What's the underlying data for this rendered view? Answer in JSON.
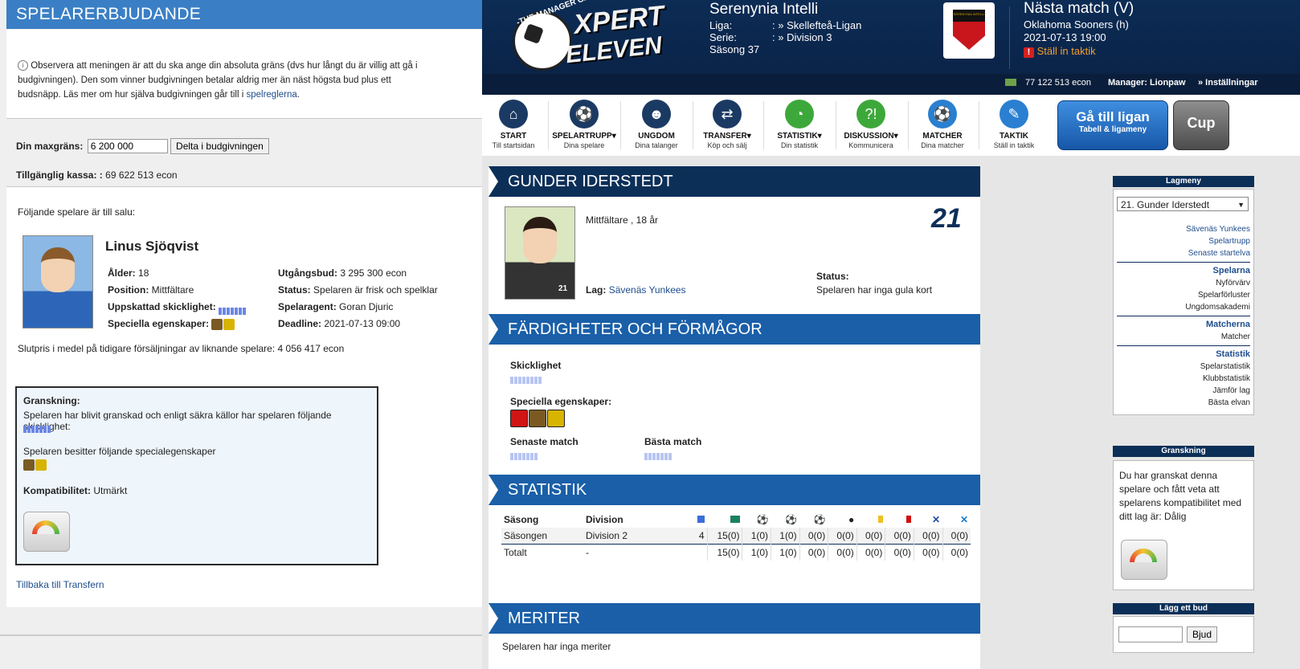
{
  "left": {
    "title": "SPELARERBJUDANDE",
    "info_text": "Observera att meningen är att du ska ange din absoluta gräns (dvs hur långt du är villig att gå i budgivningen). Den som vinner budgivningen betalar aldrig mer än näst högsta bud plus ett budsnäpp. Läs mer om hur själva budgivningen går till i",
    "info_link": "spelreglerna",
    "info_end": ".",
    "max_label": "Din maxgräns:",
    "max_value": "6 200 000",
    "join_button": "Delta i budgivningen",
    "cash_label": "Tillgänglig kassa: :",
    "cash_value": "69 622 513 econ",
    "for_sale_text": "Följande spelare är till salu:",
    "player": {
      "name": "Linus Sjöqvist",
      "age_label": "Ålder:",
      "age": "18",
      "position_label": "Position:",
      "position": "Mittfältare",
      "skill_label": "Uppskattad skicklighet:",
      "special_label": "Speciella egenskaper:",
      "start_bid_label": "Utgångsbud:",
      "start_bid": "3 295 300 econ",
      "status_label": "Status:",
      "status": "Spelaren är frisk och spelklar",
      "agent_label": "Spelaragent:",
      "agent": "Goran Djuric",
      "deadline_label": "Deadline:",
      "deadline": "2021-07-13 09:00",
      "skill_level": 7
    },
    "avg_price_text": "Slutpris i medel på tidigare försäljningar av liknande spelare: 4 056 417 econ",
    "scout": {
      "title": "Granskning:",
      "text1": "Spelaren har blivit granskad och enligt säkra källor har spelaren följande skicklighet:",
      "text2": "Spelaren besitter följande specialegenskaper",
      "compat_label": "Kompatibilitet:",
      "compat_value": "Utmärkt"
    },
    "back_link": "Tillbaka till Transfern"
  },
  "header": {
    "logo_text1": "-THE MANAGER GAME-",
    "logo_text2": "XPERT",
    "logo_text3": "ELEVEN",
    "team_name": "Serenynia Intelli",
    "liga_label": "Liga:",
    "liga_value": ": » Skellefteå-Ligan",
    "serie_label": "Serie:",
    "serie_value": ": » Division 3",
    "season": "Säsong 37",
    "badge_text": "SERENYNIA INTELLI",
    "next_match_title": "Nästa match (V)",
    "next_opponent": "Oklahoma Sooners (h)",
    "next_date": "2021-07-13 19:00",
    "tactic_link": "Ställ in taktik",
    "money": "77 122 513 econ",
    "manager": "Manager: Lionpaw",
    "settings": "» Inställningar"
  },
  "nav": [
    {
      "t1": "START",
      "t2": "Till startsidan",
      "icon": "home-icon"
    },
    {
      "t1": "SPELARTRUPP▾",
      "t2": "Dina spelare",
      "icon": "player-icon"
    },
    {
      "t1": "UNGDOM",
      "t2": "Dina talanger",
      "icon": "youth-icon"
    },
    {
      "t1": "TRANSFER▾",
      "t2": "Köp och sälj",
      "icon": "transfer-icon"
    },
    {
      "t1": "STATISTIK▾",
      "t2": "Din statistik",
      "icon": "stats-icon"
    },
    {
      "t1": "DISKUSSION▾",
      "t2": "Kommunicera",
      "icon": "discussion-icon"
    },
    {
      "t1": "MATCHER",
      "t2": "Dina matcher",
      "icon": "ball-icon"
    },
    {
      "t1": "TAKTIK",
      "t2": "Ställ in taktik",
      "icon": "tactic-icon"
    }
  ],
  "league_button": {
    "t1": "Gå till ligan",
    "t2": "Tabell & ligameny"
  },
  "cup_button": "Cup",
  "player_page": {
    "name": "GUNDER IDERSTEDT",
    "number": "21",
    "desc": "Mittfältare , 18 år",
    "team_label": "Lag:",
    "team": "Sävenäs Yunkees",
    "status_label": "Status:",
    "status_text": "Spelaren har inga gula kort",
    "skills_title": "FÄRDIGHETER OCH FÖRMÅGOR",
    "skill_label": "Skicklighet",
    "special_label": "Speciella egenskaper:",
    "last_match_label": "Senaste match",
    "best_match_label": "Bästa match",
    "stats_title": "STATISTIK",
    "col_season": "Säsong",
    "col_division": "Division",
    "rows": [
      {
        "season": "Säsongen",
        "division": "Division 2",
        "c0": "4",
        "vals": [
          "15(0)",
          "1(0)",
          "1(0)",
          "0(0)",
          "0(0)",
          "0(0)",
          "0(0)",
          "0(0)",
          "0(0)"
        ]
      },
      {
        "season": "Totalt",
        "division": "-",
        "c0": "",
        "vals": [
          "15(0)",
          "1(0)",
          "1(0)",
          "0(0)",
          "0(0)",
          "0(0)",
          "0(0)",
          "0(0)",
          "0(0)"
        ]
      }
    ],
    "merits_title": "MERITER",
    "merits_text": "Spelaren har inga meriter"
  },
  "sidebar": {
    "menu_title": "Lagmeny",
    "select_value": "21. Gunder Iderstedt",
    "links1": [
      "Sävenäs Yunkees",
      "Spelartrupp",
      "Senaste startelva"
    ],
    "h_players": "Spelarna",
    "links2": [
      "Nyförvärv",
      "Spelarförluster",
      "Ungdomsakademi"
    ],
    "h_matches": "Matcherna",
    "links3": [
      "Matcher"
    ],
    "h_stats": "Statistik",
    "links4": [
      "Spelarstatistik",
      "Klubbstatistik",
      "Jämför lag",
      "Bästa elvan"
    ],
    "scout_title": "Granskning",
    "scout_text": "Du har granskat denna spelare och fått veta att spelarens kompatibilitet med ditt lag är: Dålig",
    "bid_title": "Lägg ett bud",
    "bid_button": "Bjud"
  }
}
